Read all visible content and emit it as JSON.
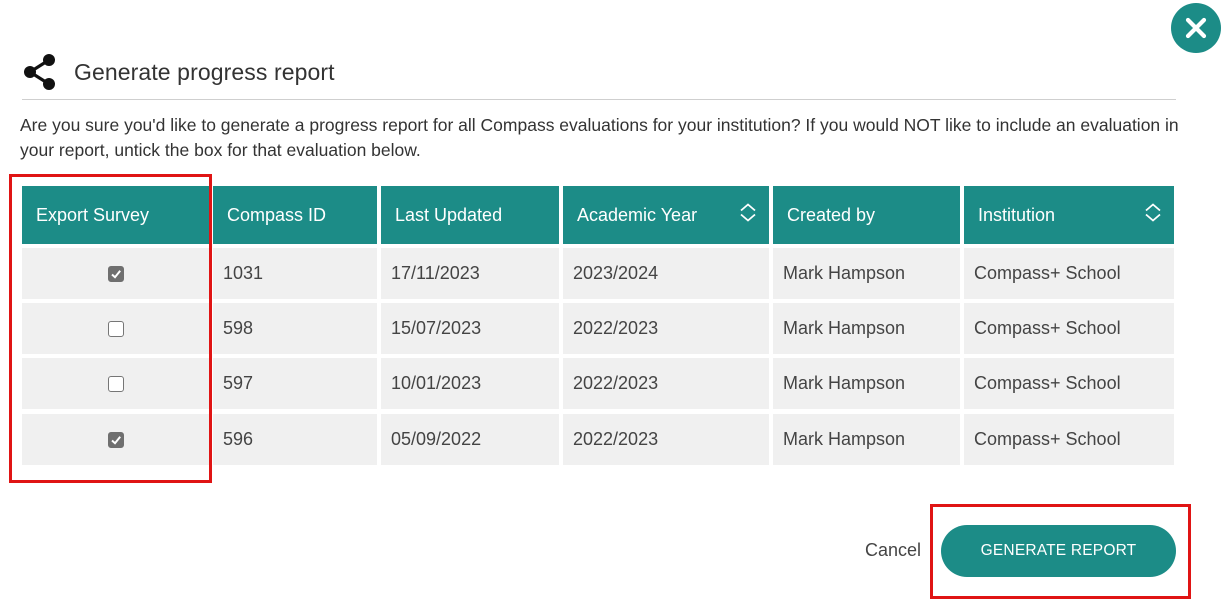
{
  "dialog": {
    "title": "Generate progress report",
    "intro": "Are you sure you'd like to generate a progress report for all Compass evaluations for your institution? If you would NOT like to include an evaluation in your report, untick the box for that evaluation below."
  },
  "table": {
    "headers": [
      "Export Survey",
      "Compass ID",
      "Last Updated",
      "Academic Year",
      "Created by",
      "Institution"
    ],
    "rows": [
      {
        "checked": true,
        "id": "1031",
        "updated": "17/11/2023",
        "year": "2023/2024",
        "creator": "Mark Hampson",
        "institution": "Compass+ School"
      },
      {
        "checked": false,
        "id": "598",
        "updated": "15/07/2023",
        "year": "2022/2023",
        "creator": "Mark Hampson",
        "institution": "Compass+ School"
      },
      {
        "checked": false,
        "id": "597",
        "updated": "10/01/2023",
        "year": "2022/2023",
        "creator": "Mark Hampson",
        "institution": "Compass+ School"
      },
      {
        "checked": true,
        "id": "596",
        "updated": "05/09/2022",
        "year": "2022/2023",
        "creator": "Mark Hampson",
        "institution": "Compass+ School"
      }
    ]
  },
  "actions": {
    "cancel_label": "Cancel",
    "generate_label": "GENERATE REPORT"
  },
  "icons": {
    "close": "close-icon",
    "share": "share-icon",
    "sort": "sort-icon"
  },
  "colors": {
    "accent": "#1c8c87",
    "highlight": "#e01414",
    "row_bg": "#f0f0f0"
  }
}
